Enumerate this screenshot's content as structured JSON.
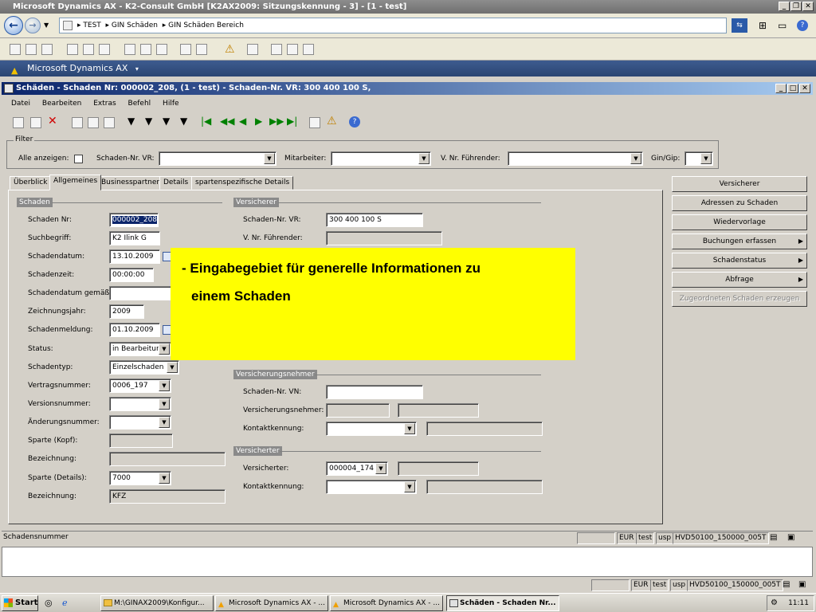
{
  "window": {
    "title": "Microsoft Dynamics AX - K2-Consult GmbH [K2AX2009: Sitzungskennung - 3] - [1 - test]"
  },
  "address": {
    "crumbs": [
      "TEST",
      "GIN Schäden",
      "GIN Schäden Bereich"
    ]
  },
  "brand": {
    "label": "Microsoft Dynamics AX"
  },
  "form": {
    "title": "Schäden - Schaden Nr: 000002_208, (1 - test) - Schaden-Nr. VR: 300 400 100 S,",
    "menu": [
      "Datei",
      "Bearbeiten",
      "Extras",
      "Befehl",
      "Hilfe"
    ]
  },
  "filter": {
    "legend": "Filter",
    "show_all_label": "Alle anzeigen:",
    "schaden_vr_label": "Schaden-Nr. VR:",
    "mitarbeiter_label": "Mitarbeiter:",
    "fuehrender_label": "V. Nr. Führender:",
    "gin_gip_label": "Gin/Gip:"
  },
  "tabs": [
    "Überblick",
    "Allgemeines",
    "Businesspartner",
    "Details",
    "spartenspezifische Details"
  ],
  "schaden": {
    "header": "Schaden",
    "fields": {
      "nr_label": "Schaden Nr:",
      "nr_value": "000002_208",
      "such_label": "Suchbegriff:",
      "such_value": "K2 Ilink G",
      "datum_label": "Schadendatum:",
      "datum_value": "13.10.2009",
      "zeit_label": "Schadenzeit:",
      "zeit_value": "00:00:00",
      "gemaess_label": "Schadendatum gemäß:",
      "jahr_label": "Zeichnungsjahr:",
      "jahr_value": "2009",
      "meldung_label": "Schadenmeldung:",
      "meldung_value": "01.10.2009",
      "status_label": "Status:",
      "status_value": "in Bearbeitung",
      "typ_label": "Schadentyp:",
      "typ_value": "Einzelschaden",
      "vertrag_label": "Vertragsnummer:",
      "vertrag_value": "0006_197",
      "version_label": "Versionsnummer:",
      "aenderung_label": "Änderungsnummer:",
      "sparte_kopf_label": "Sparte (Kopf):",
      "bez1_label": "Bezeichnung:",
      "sparte_det_label": "Sparte (Details):",
      "sparte_det_value": "7000",
      "bez2_label": "Bezeichnung:",
      "bez2_value": "KFZ"
    }
  },
  "versicherer": {
    "header": "Versicherer",
    "vr_label": "Schaden-Nr. VR:",
    "vr_value": "300 400 100 S",
    "fuehrender_label": "V. Nr. Führender:"
  },
  "versicherungsnehmer": {
    "header": "Versicherungsnehmer",
    "vn_label": "Schaden-Nr. VN:",
    "name_label": "Versicherungsnehmer:",
    "kontakt_label": "Kontaktkennung:"
  },
  "versicherter": {
    "header": "Versicherter",
    "name_label": "Versicherter:",
    "name_value": "000004_174",
    "kontakt_label": "Kontaktkennung:"
  },
  "side_buttons": [
    {
      "label": "Versicherer"
    },
    {
      "label": "Adressen zu Schaden"
    },
    {
      "label": "Wiedervorlage"
    },
    {
      "label": "Buchungen erfassen"
    },
    {
      "label": "Schadenstatus"
    },
    {
      "label": "Abfrage"
    },
    {
      "label": "Zugeordneten Schaden erzeugen"
    }
  ],
  "callout": {
    "line1": "- Eingabegebiet für generelle Informationen zu",
    "line2": "einem Schaden"
  },
  "status1": {
    "text": "Schadensnummer",
    "cells": [
      "EUR",
      "test",
      "usp",
      "HVD50100_150000_005T"
    ]
  },
  "status2": {
    "cells": [
      "EUR",
      "test",
      "usp",
      "HVD50100_150000_005T"
    ]
  },
  "taskbar": {
    "start": "Start",
    "tasks": [
      "M:\\GINAX2009\\Konfigur...",
      "Microsoft Dynamics AX - ...",
      "Microsoft Dynamics AX - ...",
      "Schäden - Schaden Nr..."
    ],
    "clock": "11:11"
  }
}
